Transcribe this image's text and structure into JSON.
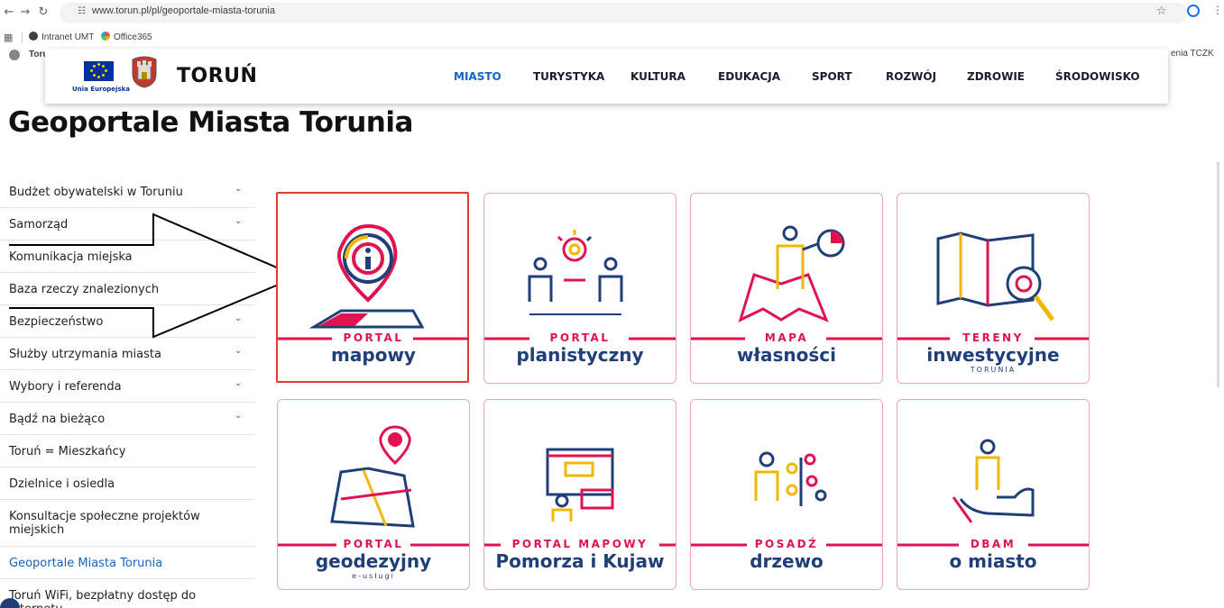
{
  "browser": {
    "url": "www.torun.pl/pl/geoportale-miasta-torunia",
    "bookmarks": [
      "Intranet UMT",
      "Office365"
    ],
    "under_left": "Toruń",
    "under_right": "enia TCZK"
  },
  "header": {
    "eu_label": "Unia Europejska",
    "brand": "TORUŃ",
    "nav": [
      "MIASTO",
      "TURYSTYKA",
      "KULTURA",
      "EDUKACJA",
      "SPORT",
      "ROZWÓJ",
      "ZDROWIE",
      "ŚRODOWISKO"
    ],
    "active_nav": "MIASTO"
  },
  "page": {
    "title": "Geoportale Miasta Torunia"
  },
  "sidebar": {
    "items": [
      {
        "label": "Budżet obywatelski w Toruniu",
        "expandable": true
      },
      {
        "label": "Samorząd",
        "expandable": true
      },
      {
        "label": "Komunikacja miejska",
        "expandable": false
      },
      {
        "label": "Baza rzeczy znalezionych",
        "expandable": false
      },
      {
        "label": "Bezpieczeństwo",
        "expandable": true
      },
      {
        "label": "Służby utrzymania miasta",
        "expandable": true
      },
      {
        "label": "Wybory i referenda",
        "expandable": true
      },
      {
        "label": "Bądź na bieżąco",
        "expandable": true
      },
      {
        "label": "Toruń = Mieszkańcy",
        "expandable": false
      },
      {
        "label": "Dzielnice i osiedla",
        "expandable": false
      },
      {
        "label": "Konsultacje społeczne projektów miejskich",
        "expandable": false
      },
      {
        "label": "Geoportale Miasta Torunia",
        "expandable": false,
        "active": true
      },
      {
        "label": "Toruń WiFi, bezpłatny dostęp do internetu",
        "expandable": false
      }
    ]
  },
  "tiles": [
    {
      "top": "PORTAL",
      "main": "mapowy",
      "sub": "",
      "icon": "map-pin-info-icon",
      "selected": true
    },
    {
      "top": "PORTAL",
      "main": "planistyczny",
      "sub": "",
      "icon": "planning-people-icon"
    },
    {
      "top": "MAPA",
      "main": "własności",
      "sub": "",
      "icon": "ownership-map-icon"
    },
    {
      "top": "TERENY",
      "main": "inwestycyjne",
      "sub": "TORUNIA",
      "icon": "investment-map-icon"
    },
    {
      "top": "PORTAL",
      "main": "geodezyjny",
      "sub": "e-usługi",
      "icon": "geodesy-map-icon"
    },
    {
      "top": "PORTAL MAPOWY",
      "main": "Pomorza i Kujaw",
      "sub": "",
      "icon": "regional-portal-icon"
    },
    {
      "top": "POSADŹ",
      "main": "drzewo",
      "sub": "",
      "icon": "plant-tree-icon"
    },
    {
      "top": "DBAM",
      "main": "o miasto",
      "sub": "",
      "icon": "city-care-icon"
    }
  ],
  "colors": {
    "accent_red": "#e0124f",
    "navy": "#1f3f78",
    "yellow": "#f2b705",
    "link_blue": "#1565c0"
  }
}
